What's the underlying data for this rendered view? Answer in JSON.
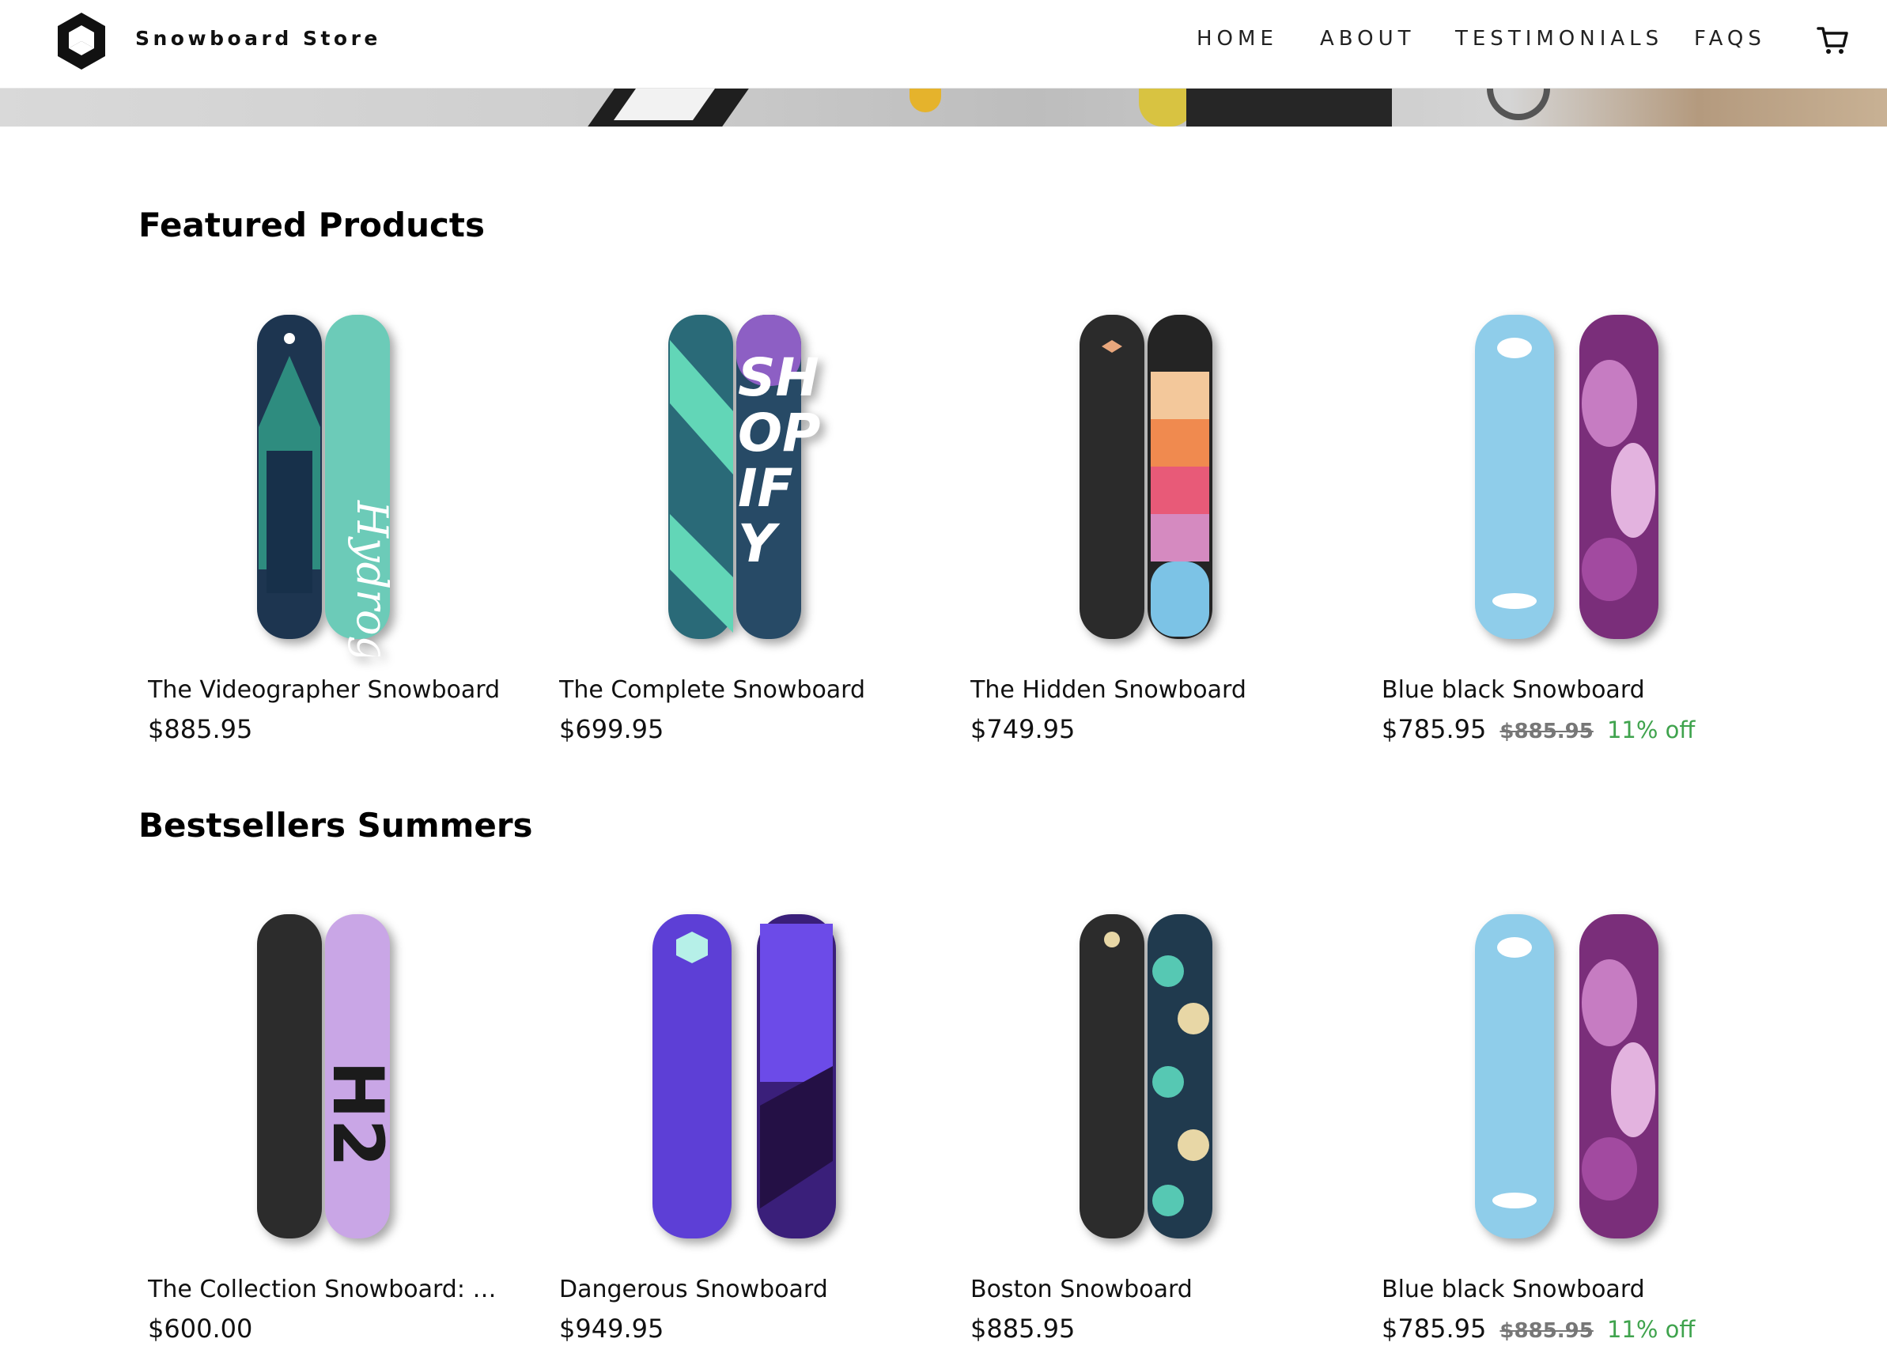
{
  "header": {
    "brand": "Snowboard Store",
    "nav": [
      "HOME",
      "ABOUT",
      "TESTIMONIALS",
      "FAQS"
    ],
    "icons": {
      "logo": "hexagon-logo-icon",
      "cart": "cart-icon"
    }
  },
  "sections": [
    {
      "title": "Featured Products",
      "products": [
        {
          "name": "The Videographer Snowboard",
          "price": "$885.95"
        },
        {
          "name": "The Complete Snowboard",
          "price": "$699.95"
        },
        {
          "name": "The Hidden Snowboard",
          "price": "$749.95"
        },
        {
          "name": "Blue black Snowboard",
          "price": "$785.95",
          "compare": "$885.95",
          "discount": "11% off"
        }
      ]
    },
    {
      "title": "Bestsellers Summers",
      "products": [
        {
          "name": "The Collection Snowboard: Hy...",
          "price": "$600.00"
        },
        {
          "name": "Dangerous Snowboard",
          "price": "$949.95"
        },
        {
          "name": "Boston Snowboard",
          "price": "$885.95"
        },
        {
          "name": "Blue black Snowboard",
          "price": "$785.95",
          "compare": "$885.95",
          "discount": "11% off"
        }
      ]
    }
  ],
  "colors": {
    "discount": "#3fa34d",
    "compare": "#777777",
    "text": "#111111"
  }
}
